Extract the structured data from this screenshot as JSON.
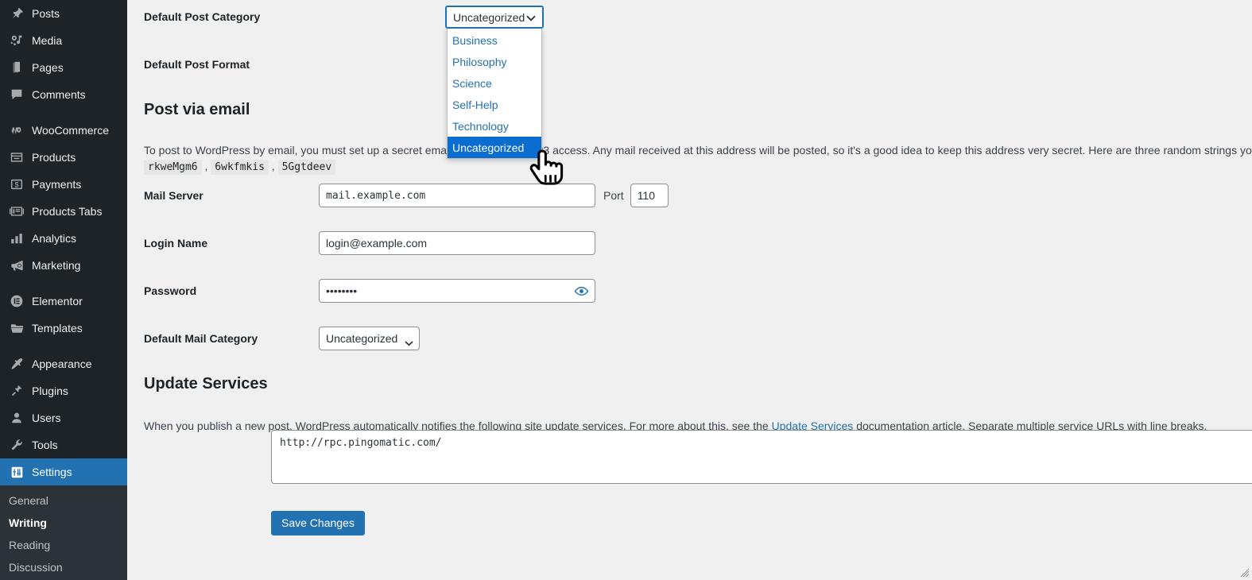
{
  "sidebar": {
    "items": [
      {
        "label": "Posts",
        "icon": "pushpin-icon",
        "current": false
      },
      {
        "label": "Media",
        "icon": "media-icon",
        "current": false
      },
      {
        "label": "Pages",
        "icon": "pages-icon",
        "current": false
      },
      {
        "label": "Comments",
        "icon": "comment-icon",
        "current": false
      },
      {
        "label": "WooCommerce",
        "icon": "woocommerce-icon",
        "current": false
      },
      {
        "label": "Products",
        "icon": "products-icon",
        "current": false
      },
      {
        "label": "Payments",
        "icon": "payments-icon",
        "current": false
      },
      {
        "label": "Products Tabs",
        "icon": "products-tabs-icon",
        "current": false
      },
      {
        "label": "Analytics",
        "icon": "analytics-icon",
        "current": false
      },
      {
        "label": "Marketing",
        "icon": "marketing-icon",
        "current": false
      },
      {
        "label": "Elementor",
        "icon": "elementor-icon",
        "current": false
      },
      {
        "label": "Templates",
        "icon": "templates-icon",
        "current": false
      },
      {
        "label": "Appearance",
        "icon": "appearance-icon",
        "current": false
      },
      {
        "label": "Plugins",
        "icon": "plugins-icon",
        "current": false
      },
      {
        "label": "Users",
        "icon": "users-icon",
        "current": false
      },
      {
        "label": "Tools",
        "icon": "tools-icon",
        "current": false
      },
      {
        "label": "Settings",
        "icon": "settings-icon",
        "current": true
      }
    ],
    "submenu": [
      {
        "label": "General",
        "current": false
      },
      {
        "label": "Writing",
        "current": true
      },
      {
        "label": "Reading",
        "current": false
      },
      {
        "label": "Discussion",
        "current": false
      }
    ],
    "colors": {
      "background": "#1d2327",
      "submenu_background": "#2c3338",
      "active": "#2271b1"
    }
  },
  "main": {
    "default_post_category": {
      "label": "Default Post Category",
      "selected": "Uncategorized",
      "open": true,
      "options": [
        "Business",
        "Philosophy",
        "Science",
        "Self-Help",
        "Technology",
        "Uncategorized"
      ],
      "highlighted": "Uncategorized"
    },
    "default_post_format": {
      "label": "Default Post Format"
    },
    "post_via_email": {
      "heading": "Post via email",
      "description_before": "To post to WordPress by email, you must set up a secret email account with POP3 access. Any mail received at this address will be posted, so it's a good idea to keep this address very secret. Here are three random strings you could use:",
      "random_strings": [
        "rkweMgm6",
        "6wkfmkis",
        "5Ggtdeev"
      ],
      "mail_server": {
        "label": "Mail Server",
        "value": "mail.example.com",
        "port_label": "Port",
        "port_value": "110"
      },
      "login_name": {
        "label": "Login Name",
        "value": "login@example.com"
      },
      "password": {
        "label": "Password",
        "value": "••••••••",
        "toggle_icon": "eye-icon"
      },
      "default_mail_category": {
        "label": "Default Mail Category",
        "selected": "Uncategorized"
      }
    },
    "update_services": {
      "heading": "Update Services",
      "description_part1": "When you publish a new post, WordPress automatically notifies the following site update services. For more about this, see the ",
      "link_text": "Update Services",
      "description_part2": " documentation article. Separate multiple service URLs with line breaks.",
      "textarea_value": "http://rpc.pingomatic.com/"
    },
    "save_button": "Save Changes"
  },
  "cursor": {
    "type": "pointer-hand-cursor"
  },
  "colors": {
    "accent": "#2271b1",
    "dropdown_highlight": "#0a6ed1",
    "page_background": "#f0f0f1",
    "text": "#1d2327"
  }
}
